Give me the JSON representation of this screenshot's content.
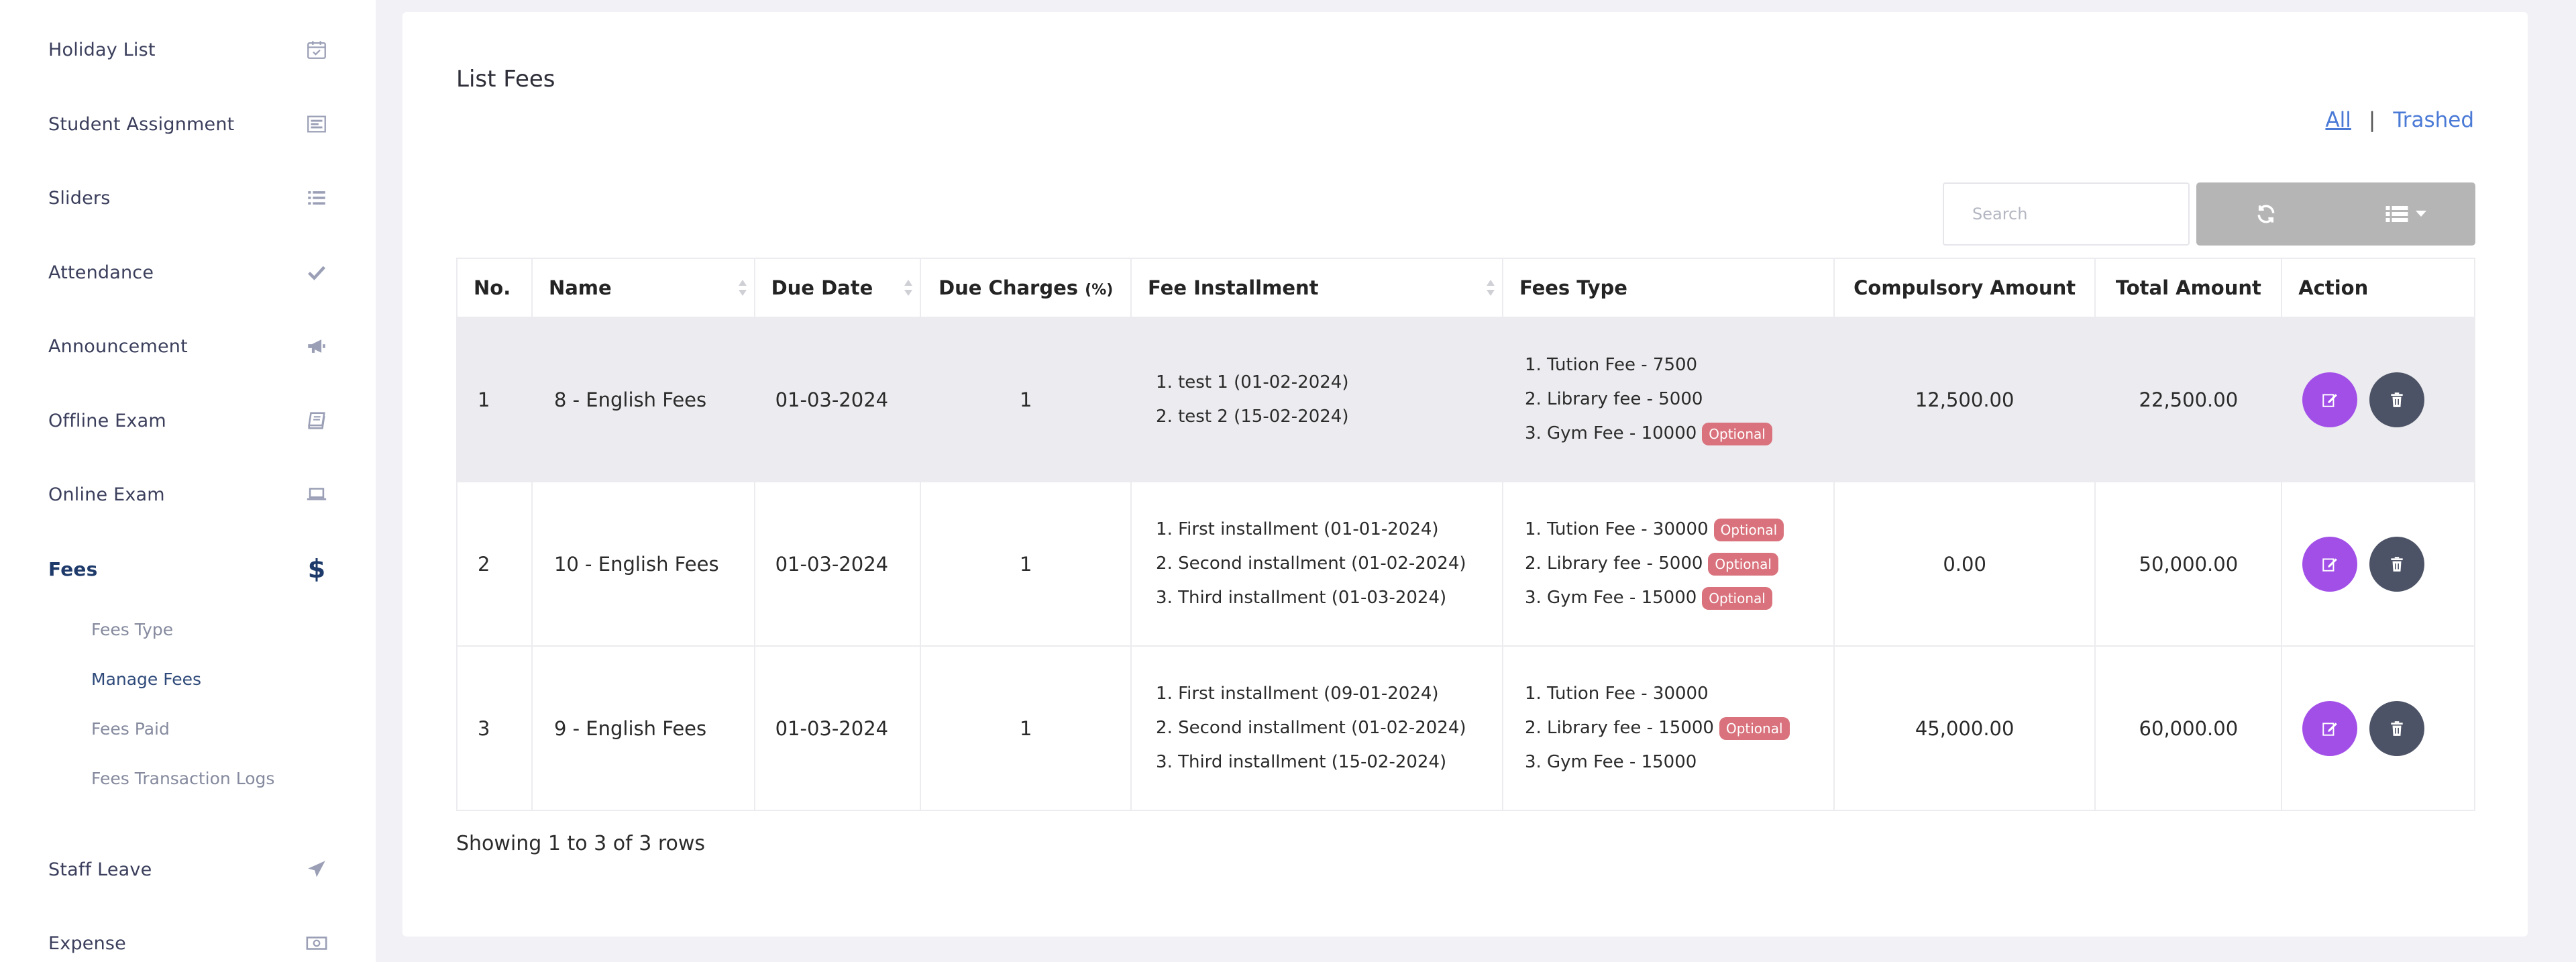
{
  "sidebar": {
    "items": [
      {
        "label": "Holiday List",
        "icon": "calendar-check-icon"
      },
      {
        "label": "Student Assignment",
        "icon": "tasks-icon"
      },
      {
        "label": "Sliders",
        "icon": "list-icon"
      },
      {
        "label": "Attendance",
        "icon": "check-icon"
      },
      {
        "label": "Announcement",
        "icon": "bullhorn-icon"
      },
      {
        "label": "Offline Exam",
        "icon": "book-icon"
      },
      {
        "label": "Online Exam",
        "icon": "laptop-icon"
      },
      {
        "label": "Fees",
        "icon": "dollar-icon"
      },
      {
        "label": "Staff Leave",
        "icon": "plane-icon"
      },
      {
        "label": "Expense",
        "icon": "money-icon"
      }
    ],
    "fees_sub": [
      "Fees Type",
      "Manage Fees",
      "Fees Paid",
      "Fees Transaction Logs"
    ]
  },
  "main": {
    "title": "List Fees",
    "filters": {
      "all": "All",
      "separator": "|",
      "trashed": "Trashed"
    },
    "search_placeholder": "Search",
    "headers": [
      "No.",
      "Name",
      "Due Date",
      "Due Charges",
      "(%)",
      "Fee Installment",
      "Fees Type",
      "Compulsory Amount",
      "Total Amount",
      "Action"
    ],
    "optional_label": "Optional",
    "rows": [
      {
        "no": "1",
        "name": "8 - English Fees",
        "due_date": "01-03-2024",
        "due_charges": "1",
        "installments": [
          "1. test 1 (01-02-2024)",
          "2. test 2 (15-02-2024)"
        ],
        "fees_types": [
          "1. Tution Fee - 7500",
          "2. Library fee - 5000",
          "3. Gym Fee - 10000"
        ],
        "compulsory": "12,500.00",
        "total": "22,500.00"
      },
      {
        "no": "2",
        "name": "10 - English Fees",
        "due_date": "01-03-2024",
        "due_charges": "1",
        "installments": [
          "1. First installment (01-01-2024)",
          "2. Second installment (01-02-2024)",
          "3. Third installment (01-03-2024)"
        ],
        "fees_types": [
          "1. Tution Fee - 30000",
          "2. Library fee - 5000",
          "3. Gym Fee - 15000"
        ],
        "compulsory": "0.00",
        "total": "50,000.00"
      },
      {
        "no": "3",
        "name": "9 - English Fees",
        "due_date": "01-03-2024",
        "due_charges": "1",
        "installments": [
          "1. First installment (09-01-2024)",
          "2. Second installment (01-02-2024)",
          "3. Third installment (15-02-2024)"
        ],
        "fees_types": [
          "1. Tution Fee - 30000",
          "2. Library fee - 15000",
          "3. Gym Fee - 15000"
        ],
        "compulsory": "45,000.00",
        "total": "60,000.00"
      }
    ],
    "footer": "Showing 1 to 3 of 3 rows"
  },
  "colors": {
    "background": "#f2f1f6",
    "link": "#4a7ad6",
    "edit_button": "#a24fe8",
    "delete_button": "#4d5366",
    "optional_badge": "#d9727c",
    "active_nav": "#1e3a6a"
  }
}
